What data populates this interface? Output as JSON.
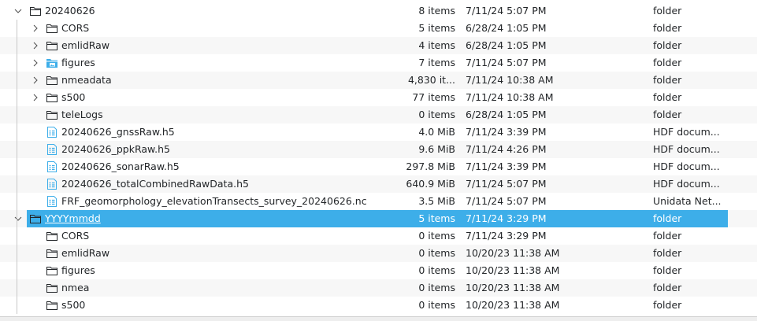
{
  "rows": [
    {
      "name": "20240626",
      "size": "8 items",
      "date": "7/11/24 5:07 PM",
      "type": "folder",
      "icon": "folder-icon",
      "depth": 0,
      "expander": "expanded",
      "alt": false,
      "selected": false
    },
    {
      "name": "CORS",
      "size": "5 items",
      "date": "6/28/24 1:05 PM",
      "type": "folder",
      "icon": "folder-icon",
      "depth": 1,
      "expander": "collapsed",
      "alt": false,
      "selected": false
    },
    {
      "name": "emlidRaw",
      "size": "4 items",
      "date": "6/28/24 1:05 PM",
      "type": "folder",
      "icon": "folder-icon",
      "depth": 1,
      "expander": "collapsed",
      "alt": true,
      "selected": false
    },
    {
      "name": "figures",
      "size": "7 items",
      "date": "7/11/24 5:07 PM",
      "type": "folder",
      "icon": "image-folder-icon",
      "depth": 1,
      "expander": "collapsed",
      "alt": false,
      "selected": false
    },
    {
      "name": "nmeadata",
      "size": "4,830 it...",
      "date": "7/11/24 10:38 AM",
      "type": "folder",
      "icon": "folder-icon",
      "depth": 1,
      "expander": "collapsed",
      "alt": true,
      "selected": false
    },
    {
      "name": "s500",
      "size": "77 items",
      "date": "7/11/24 10:38 AM",
      "type": "folder",
      "icon": "folder-icon",
      "depth": 1,
      "expander": "collapsed",
      "alt": false,
      "selected": false
    },
    {
      "name": "teleLogs",
      "size": "0 items",
      "date": "6/28/24 1:05 PM",
      "type": "folder",
      "icon": "folder-icon",
      "depth": 1,
      "expander": "none",
      "alt": true,
      "selected": false
    },
    {
      "name": "20240626_gnssRaw.h5",
      "size": "4.0 MiB",
      "date": "7/11/24 3:39 PM",
      "type": "HDF docum...",
      "icon": "data-file-icon",
      "depth": 1,
      "expander": "none",
      "alt": false,
      "selected": false
    },
    {
      "name": "20240626_ppkRaw.h5",
      "size": "9.6 MiB",
      "date": "7/11/24 4:26 PM",
      "type": "HDF docum...",
      "icon": "data-file-icon",
      "depth": 1,
      "expander": "none",
      "alt": true,
      "selected": false
    },
    {
      "name": "20240626_sonarRaw.h5",
      "size": "297.8 MiB",
      "date": "7/11/24 3:39 PM",
      "type": "HDF docum...",
      "icon": "data-file-icon",
      "depth": 1,
      "expander": "none",
      "alt": false,
      "selected": false
    },
    {
      "name": "20240626_totalCombinedRawData.h5",
      "size": "640.9 MiB",
      "date": "7/11/24 5:07 PM",
      "type": "HDF docum...",
      "icon": "data-file-icon",
      "depth": 1,
      "expander": "none",
      "alt": true,
      "selected": false
    },
    {
      "name": "FRF_geomorphology_elevationTransects_survey_20240626.nc",
      "size": "3.5 MiB",
      "date": "7/11/24 5:07 PM",
      "type": "Unidata Net...",
      "icon": "data-file-icon",
      "depth": 1,
      "expander": "none",
      "alt": false,
      "selected": false
    },
    {
      "name": "YYYYmmdd",
      "size": "5 items",
      "date": "7/11/24 3:29 PM",
      "type": "folder",
      "icon": "folder-icon",
      "depth": 0,
      "expander": "expanded",
      "alt": true,
      "selected": true
    },
    {
      "name": "CORS",
      "size": "0 items",
      "date": "7/11/24 3:29 PM",
      "type": "folder",
      "icon": "folder-icon",
      "depth": 1,
      "expander": "none",
      "alt": false,
      "selected": false
    },
    {
      "name": "emlidRaw",
      "size": "0 items",
      "date": "10/20/23 11:38 AM",
      "type": "folder",
      "icon": "folder-icon",
      "depth": 1,
      "expander": "none",
      "alt": true,
      "selected": false
    },
    {
      "name": "figures",
      "size": "0 items",
      "date": "10/20/23 11:38 AM",
      "type": "folder",
      "icon": "folder-icon",
      "depth": 1,
      "expander": "none",
      "alt": false,
      "selected": false
    },
    {
      "name": "nmea",
      "size": "0 items",
      "date": "10/20/23 11:38 AM",
      "type": "folder",
      "icon": "folder-icon",
      "depth": 1,
      "expander": "none",
      "alt": true,
      "selected": false
    },
    {
      "name": "s500",
      "size": "0 items",
      "date": "10/20/23 11:38 AM",
      "type": "folder",
      "icon": "folder-icon",
      "depth": 1,
      "expander": "none",
      "alt": false,
      "selected": false
    }
  ],
  "colors": {
    "selection": "#3daee9",
    "icon_accent": "#3daee9",
    "alt_row": "#f7f7f7",
    "text": "#232629"
  }
}
